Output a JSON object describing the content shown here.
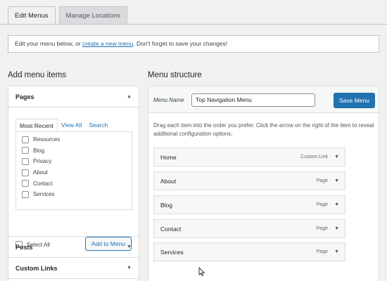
{
  "tabs": [
    {
      "label": "Edit Menus",
      "active": true
    },
    {
      "label": "Manage Locations",
      "active": false
    }
  ],
  "notice": {
    "prefix": "Edit your menu below, or ",
    "link": "create a new menu",
    "suffix": ". Don't forget to save your changes!"
  },
  "left": {
    "heading": "Add menu items",
    "pages": {
      "title": "Pages",
      "subtabs": [
        "Most Recent",
        "View All",
        "Search"
      ],
      "items": [
        "Resources",
        "Blog",
        "Privacy",
        "About",
        "Contact",
        "Services"
      ],
      "select_all": "Select All",
      "add_button": "Add to Menu"
    },
    "sections": [
      "Posts",
      "Custom Links"
    ]
  },
  "right": {
    "heading": "Menu structure",
    "menu_name_label": "Menu Name",
    "menu_name_value": "Top Navigation Menu",
    "save_button": "Save Menu",
    "drag_note": "Drag each item into the order you prefer. Click the arrow on the right of the item to reveal additional configuration options.",
    "items": [
      {
        "title": "Home",
        "type": "Custom Link"
      },
      {
        "title": "About",
        "type": "Page"
      },
      {
        "title": "Blog",
        "type": "Page"
      },
      {
        "title": "Contact",
        "type": "Page"
      },
      {
        "title": "Services",
        "type": "Page"
      }
    ]
  },
  "icons": {
    "accordion_open": "triangle-up-icon",
    "accordion_closed": "triangle-down-icon",
    "item_arrow": "triangle-down-icon",
    "cursor": "mouse-pointer-icon"
  },
  "colors": {
    "accent": "#2271b1",
    "background": "#f1f1f1"
  }
}
